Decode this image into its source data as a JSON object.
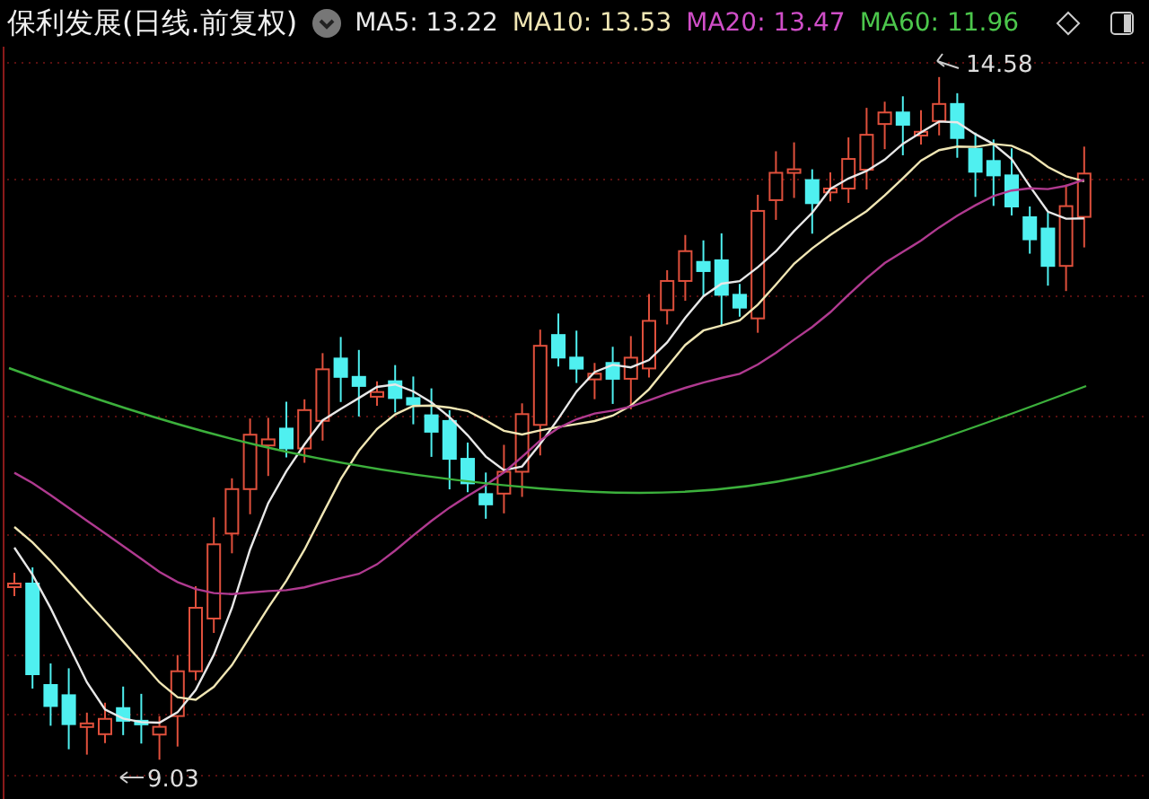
{
  "title": "保利发展(日线.前复权)",
  "indicators": [
    {
      "label": "MA5:",
      "value": "13.22",
      "color": "#e8e8e8"
    },
    {
      "label": "MA10:",
      "value": "13.53",
      "color": "#f0e6b4"
    },
    {
      "label": "MA20:",
      "value": "13.47",
      "color": "#d04ec8"
    },
    {
      "label": "MA60:",
      "value": "11.96",
      "color": "#4cc74c"
    }
  ],
  "chart": {
    "high_label": "14.58",
    "low_label": "9.03"
  }
}
